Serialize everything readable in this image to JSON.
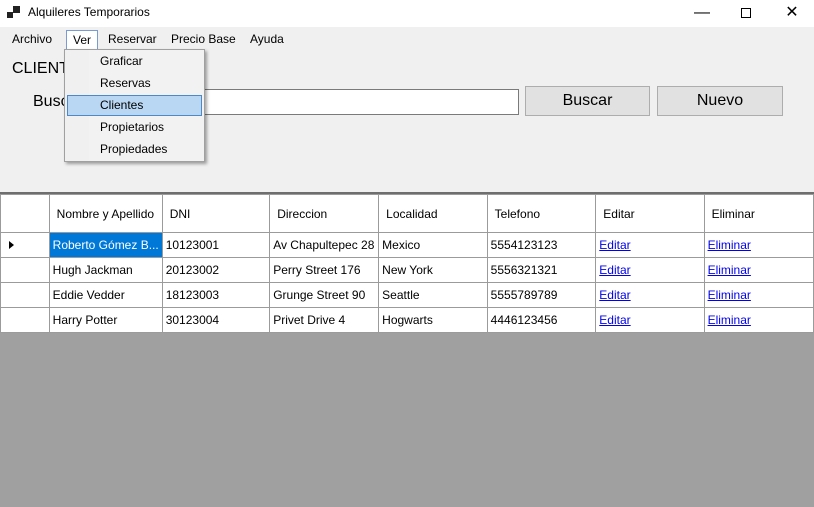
{
  "window": {
    "title": "Alquileres Temporarios"
  },
  "menubar": {
    "items": [
      "Archivo",
      "Ver",
      "Reservar",
      "Precio Base",
      "Ayuda"
    ]
  },
  "ver_menu": {
    "items": [
      "Graficar",
      "Reservas",
      "Clientes",
      "Propietarios",
      "Propiedades"
    ],
    "selected": "Clientes"
  },
  "form": {
    "section_label": "CLIENTES",
    "search_label": "Buscar",
    "search_value": "",
    "search_button": "Buscar",
    "new_button": "Nuevo"
  },
  "grid": {
    "headers": [
      "",
      "Nombre y Apellido",
      "DNI",
      "Direccion",
      "Localidad",
      "Telefono",
      "Editar",
      "Eliminar"
    ],
    "rows": [
      [
        "Roberto Gómez B...",
        "10123001",
        "Av Chapultepec 28",
        "Mexico",
        "5554123123",
        "Editar",
        "Eliminar"
      ],
      [
        "Hugh Jackman",
        "20123002",
        "Perry Street 176",
        "New York",
        "5556321321",
        "Editar",
        "Eliminar"
      ],
      [
        "Eddie Vedder",
        "18123003",
        "Grunge Street 90",
        "Seattle",
        "5555789789",
        "Editar",
        "Eliminar"
      ],
      [
        "Harry Potter",
        "30123004",
        "Privet Drive 4",
        "Hogwarts",
        "4446123456",
        "Editar",
        "Eliminar"
      ]
    ]
  },
  "colors": {
    "selection": "#0078d7",
    "menu_highlight": "#b9d7f2",
    "empty_grid": "#a0a0a0"
  }
}
